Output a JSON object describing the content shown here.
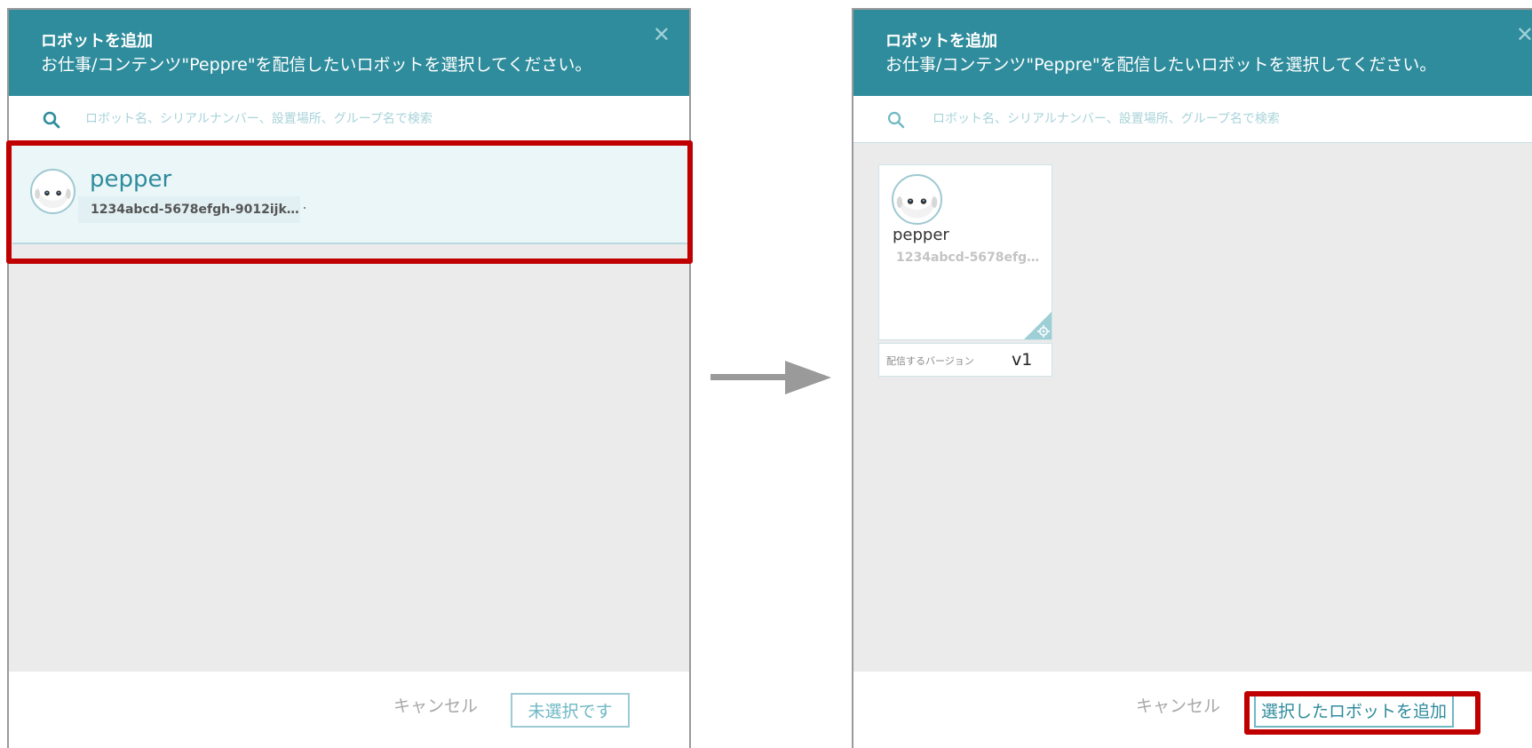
{
  "left_dialog": {
    "title": "ロボットを追加",
    "subtitle": "お仕事/コンテンツ\"Peppre\"を配信したいロボットを選択してください。",
    "search_placeholder": "ロボット名、シリアルナンバー、設置場所、グループ名で検索",
    "robot": {
      "name": "pepper",
      "serial": "1234abcd-5678efgh-9012ijk…"
    },
    "cancel_label": "キャンセル",
    "action_label": "未選択です"
  },
  "right_dialog": {
    "title": "ロボットを追加",
    "subtitle": "お仕事/コンテンツ\"Peppre\"を配信したいロボットを選択してください。",
    "search_placeholder": "ロボット名、シリアルナンバー、設置場所、グループ名で検索",
    "robot": {
      "name": "pepper",
      "serial": "1234abcd-5678efg…"
    },
    "version_label": "配信するバージョン",
    "version_value": "v1",
    "cancel_label": "キャンセル",
    "action_label": "選択したロボットを追加"
  },
  "icons": {
    "search": "search-icon",
    "close": "close-icon",
    "avatar": "pepper-robot-avatar",
    "corner": "gear-icon",
    "arrow": "right-arrow-icon"
  },
  "colors": {
    "header": "#2f8c9c",
    "highlight": "#c00000",
    "content_bg": "#ebebeb",
    "accent_light": "#9ccbd3"
  }
}
